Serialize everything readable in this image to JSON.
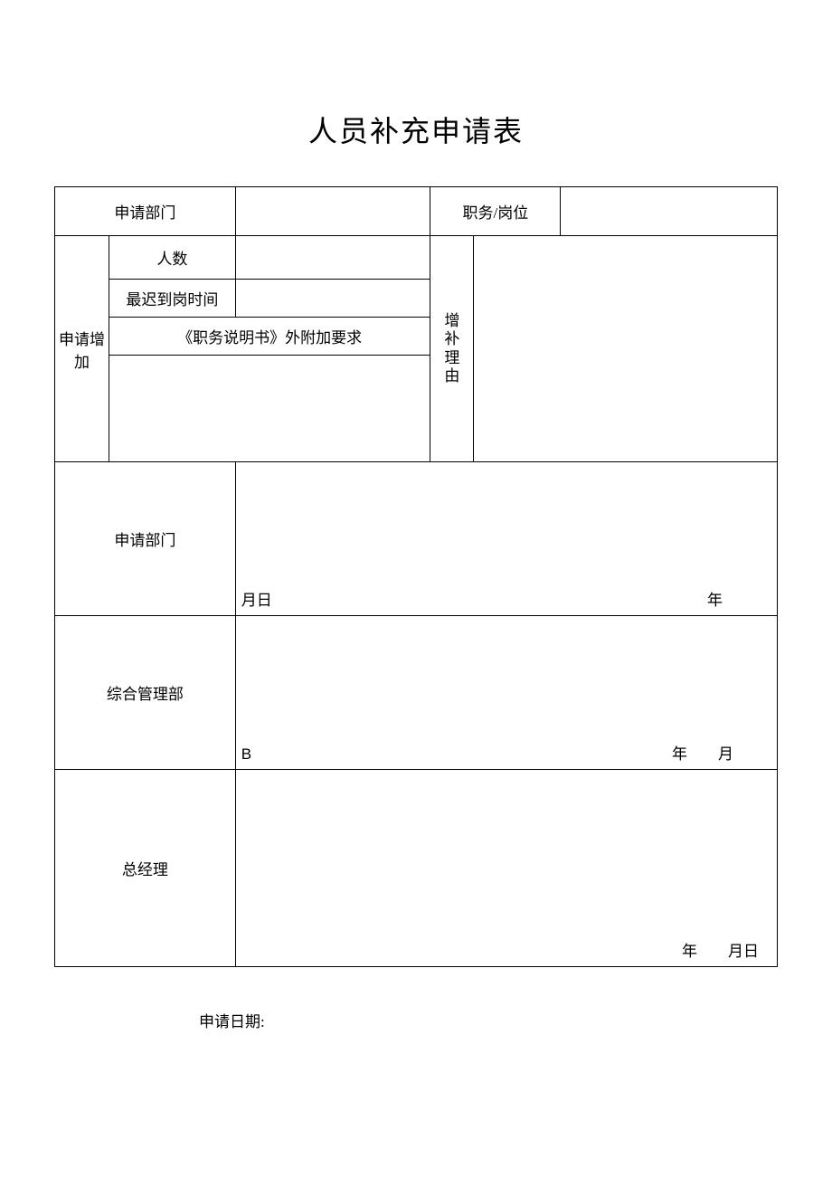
{
  "title": "人员补充申请表",
  "row1": {
    "applyDeptLabel": "申请部门",
    "positionLabel": "职务/岗位"
  },
  "row2": {
    "applyAddLabel": "申请增加",
    "countLabel": "人数",
    "latestArrivalLabel": "最迟到岗时间",
    "extraReqLabel": "《职务说明书》外附加要求",
    "supplementReasonLabel": "增\n补\n理\n由"
  },
  "sign": {
    "applyDept": "申请部门",
    "applyDeptDate": "年",
    "applyDeptMonthDay": "月日",
    "integratedMgmt": "综合管理部",
    "integratedDate": "年  月",
    "integratedB": "B",
    "gm": "总经理",
    "gmDate": "年  月日"
  },
  "applyDateLabel": "申请日期:"
}
